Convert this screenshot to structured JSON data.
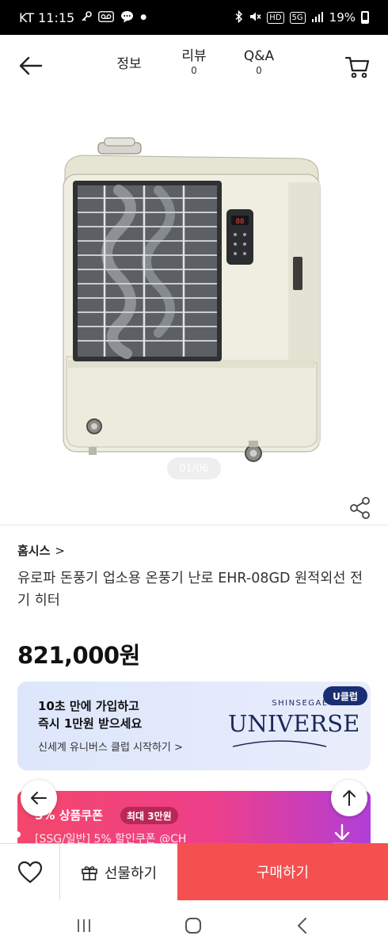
{
  "status_bar": {
    "time": "KT 11:15",
    "battery": "19%",
    "icons_left": [
      "key-icon",
      "voicemail-icon",
      "chat-bubble-icon",
      "dot-icon"
    ],
    "icons_right": [
      "bluetooth-icon",
      "mute-icon",
      "hd-icon",
      "5g-icon",
      "signal-icon",
      "battery-icon"
    ],
    "hd_label": "HD",
    "g5_label": "5G"
  },
  "header": {
    "tabs": [
      {
        "label": "정보",
        "count": ""
      },
      {
        "label": "리뷰",
        "count": "0"
      },
      {
        "label": "Q&A",
        "count": "0"
      }
    ]
  },
  "gallery": {
    "counter": "01/06"
  },
  "product": {
    "brand": "홈시스",
    "brand_chevron": ">",
    "title": "유로파 돈풍기 업소용 온풍기 난로 EHR-08GD 원적외선 전기 히터",
    "price": "821,000원"
  },
  "universe_banner": {
    "line1": "10초 만에 가입하고",
    "line2": "즉시 1만원 받으세요",
    "cta": "신세계 유니버스 클럽 시작하기 >",
    "badge": "U클럽",
    "logo_sub": "SHINSEGAE",
    "logo": "UNIVERSE"
  },
  "coupon_banner": {
    "title": "5% 상품쿠폰",
    "max_label": "최대 3만원",
    "desc": "[SSG/일반] 5% 할인쿠폰 @CH"
  },
  "bottom_bar": {
    "gift_label": "선물하기",
    "buy_label": "구매하기"
  },
  "colors": {
    "buy_button": "#f4504f",
    "universe_badge": "#1a2e73",
    "coupon_gradient_start": "#f3476b",
    "coupon_gradient_end": "#b13ed8",
    "heater_body": "#efeee0"
  }
}
